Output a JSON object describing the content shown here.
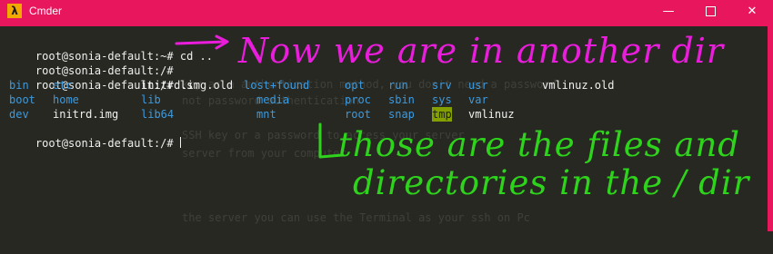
{
  "window": {
    "title": "Cmder",
    "app_icon": "λ",
    "icons": [
      "lambda-app-icon",
      "minimize-icon",
      "maximize-icon",
      "close-icon"
    ],
    "accent_color": "#e8175d"
  },
  "terminal": {
    "prompts": [
      {
        "prompt": "root@sonia-default:~#",
        "command": " cd .."
      },
      {
        "prompt": "root@sonia-default:/#",
        "command": ""
      },
      {
        "prompt": "root@sonia-default:/#",
        "command": " ls"
      },
      {
        "prompt": "root@sonia-default:/#",
        "command": " "
      }
    ],
    "ls_output": [
      [
        "bin",
        "etc",
        "initrd.img.old",
        "lost+found",
        "opt",
        "run",
        "srv",
        "usr",
        "vmlinuz.old"
      ],
      [
        "boot",
        "home",
        "lib",
        "media",
        "proc",
        "sbin",
        "sys",
        "var"
      ],
      [
        "dev",
        "initrd.img",
        "lib64",
        "mnt",
        "root",
        "snap",
        "tmp",
        "vmlinuz"
      ]
    ],
    "background_text": [
      "key as a authentication method, you don't need a password",
      "not password authentication",
      "SSH key or a password to access your server",
      "server from your computer",
      "the server you can use the Terminal as your ssh on Pc"
    ]
  },
  "annotations": {
    "top": "Now we are in another dir",
    "bottom_line1": "those are the files and",
    "bottom_line2": "directories in the / dir",
    "colors": {
      "top": "#ea1ddc",
      "bottom": "#2ed41b"
    }
  }
}
